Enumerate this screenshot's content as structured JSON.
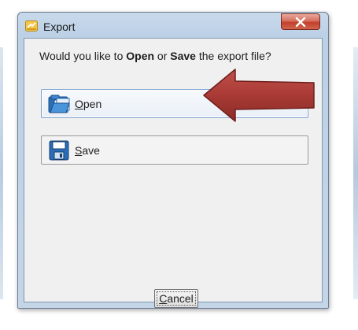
{
  "dialog": {
    "title": "Export",
    "prompt": {
      "before": "Would you like to ",
      "open_word": "Open",
      "middle": " or ",
      "save_word": "Save",
      "after": " the export file?"
    },
    "open_button": {
      "accel": "O",
      "rest": "pen"
    },
    "save_button": {
      "accel": "S",
      "rest": "ave"
    },
    "cancel_button": {
      "accel": "C",
      "rest": "ancel"
    }
  },
  "annotation": {
    "arrow_color": "#a93a35",
    "points_to": "open-button"
  },
  "colors": {
    "close_button": "#c8493a",
    "client_bg": "#f0f0f0",
    "frame": "#bcd0e6"
  }
}
